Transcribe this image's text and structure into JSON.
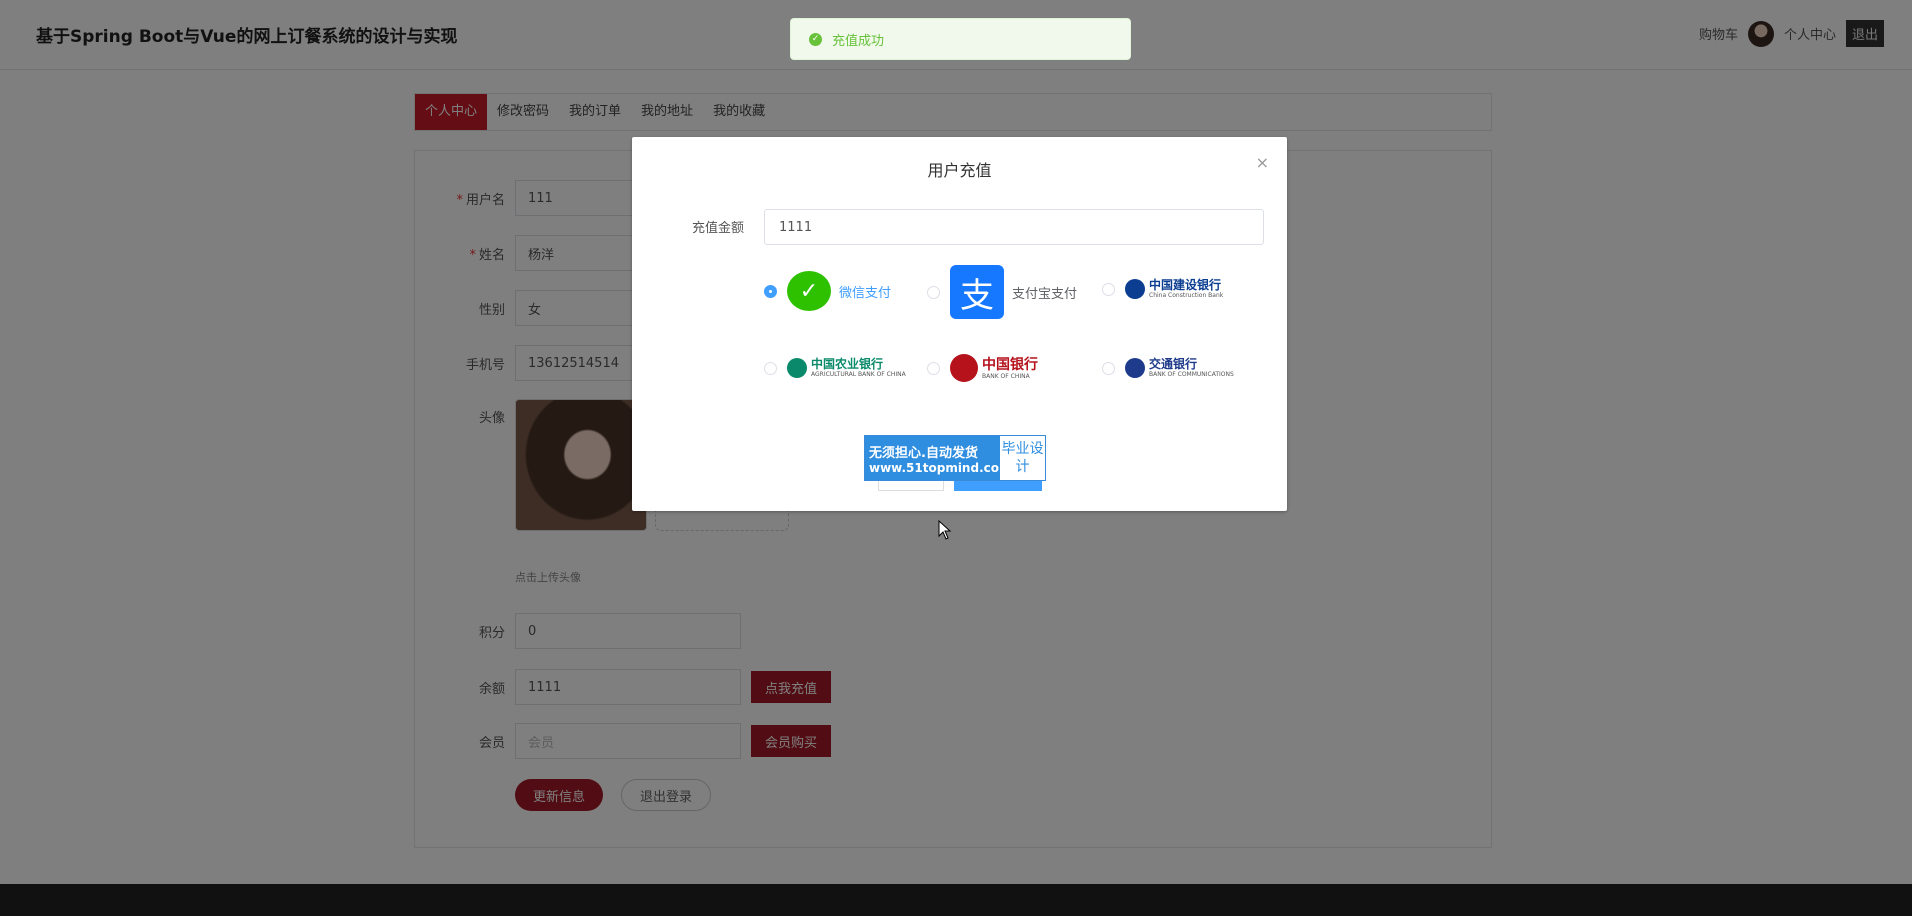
{
  "header": {
    "site_title": "基于Spring Boot与Vue的网上订餐系统的设计与实现",
    "cart": "购物车",
    "profile_center": "个人中心",
    "logout": "退出"
  },
  "tabs": [
    "个人中心",
    "修改密码",
    "我的订单",
    "我的地址",
    "我的收藏"
  ],
  "active_tab": "个人中心",
  "profile_form": {
    "username_label": "用户名",
    "username": "111",
    "name_label": "姓名",
    "name": "杨洋",
    "gender_label": "性别",
    "gender": "女",
    "phone_label": "手机号",
    "phone": "13612514514",
    "avatar_label": "头像",
    "upload_hint": "点击上传头像",
    "points_label": "积分",
    "points": "0",
    "balance_label": "余额",
    "balance": "1111",
    "recharge_btn": "点我充值",
    "member_label": "会员",
    "member_placeholder": "会员",
    "buy_member_btn": "会员购买",
    "update_btn": "更新信息",
    "logout_btn": "退出登录"
  },
  "toast": {
    "message": "充值成功",
    "color": "#67c23a"
  },
  "dialog": {
    "title": "用户充值",
    "close": "×",
    "amount_label": "充值金额",
    "amount_value": "1111",
    "payment_options": [
      {
        "label": "微信支付",
        "checked": true
      },
      {
        "label": "支付宝支付",
        "checked": false
      },
      {
        "label": "中国建设银行",
        "checked": false
      },
      {
        "label": "中国农业银行",
        "checked": false
      },
      {
        "label": "中国银行",
        "checked": false
      },
      {
        "label": "交通银行",
        "checked": false
      }
    ],
    "ccb_sub": "China Construction Bank",
    "abc_sub": "AGRICULTURAL BANK OF CHINA",
    "boc_sub": "BANK OF CHINA",
    "bocom_sub": "BANK OF COMMUNICATIONS"
  },
  "watermark": {
    "line1": "无须担心.自动发货",
    "line2": "www.51topmind.com",
    "right": "毕业设计"
  },
  "colors": {
    "brand_red": "#c91a2a",
    "primary_blue": "#409eff"
  }
}
